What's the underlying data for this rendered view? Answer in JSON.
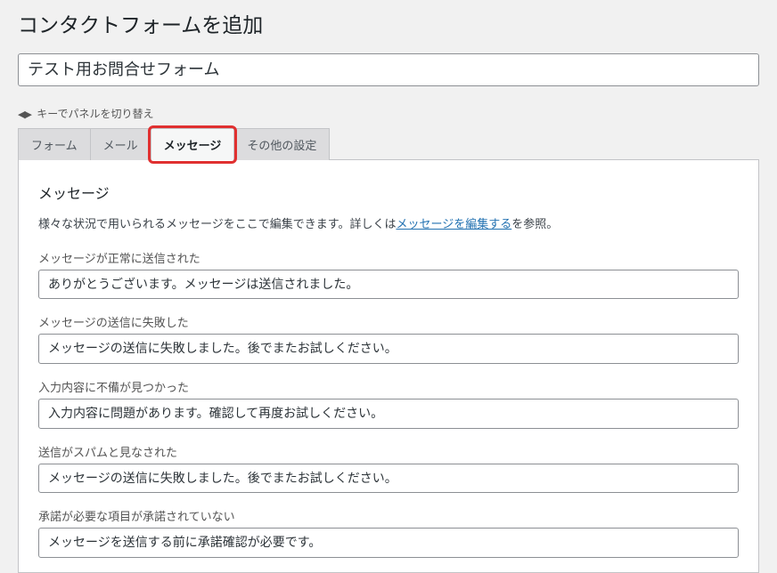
{
  "page_title": "コンタクトフォームを追加",
  "form_title_value": "テスト用お問合せフォーム",
  "keyboard_hint": "キーでパネルを切り替え",
  "tabs": {
    "form": "フォーム",
    "mail": "メール",
    "messages": "メッセージ",
    "other": "その他の設定"
  },
  "panel": {
    "heading": "メッセージ",
    "intro_pre": "様々な状況で用いられるメッセージをここで編集できます。詳しくは",
    "intro_link": "メッセージを編集する",
    "intro_post": "を参照。"
  },
  "fields": [
    {
      "label": "メッセージが正常に送信された",
      "value": "ありがとうございます。メッセージは送信されました。"
    },
    {
      "label": "メッセージの送信に失敗した",
      "value": "メッセージの送信に失敗しました。後でまたお試しください。"
    },
    {
      "label": "入力内容に不備が見つかった",
      "value": "入力内容に問題があります。確認して再度お試しください。"
    },
    {
      "label": "送信がスパムと見なされた",
      "value": "メッセージの送信に失敗しました。後でまたお試しください。"
    },
    {
      "label": "承諾が必要な項目が承諾されていない",
      "value": "メッセージを送信する前に承諾確認が必要です。"
    }
  ]
}
